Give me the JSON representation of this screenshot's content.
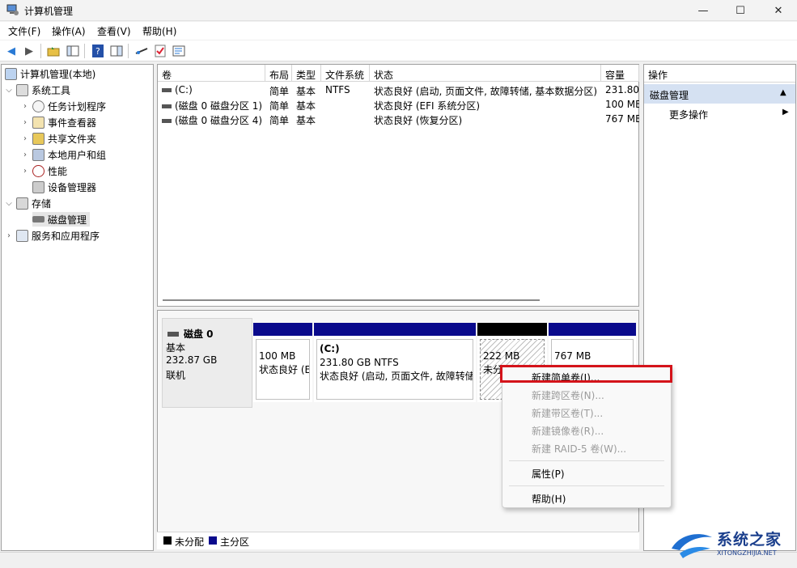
{
  "window": {
    "title": "计算机管理",
    "minimize": "—",
    "maximize": "☐",
    "close": "✕"
  },
  "menu": [
    "文件(F)",
    "操作(A)",
    "查看(V)",
    "帮助(H)"
  ],
  "toolbar_icons": [
    "back-arrow-icon",
    "forward-arrow-icon",
    "up-folder-icon",
    "console-tree-icon",
    "help-icon",
    "show-pane-icon",
    "connect-icon",
    "check-icon",
    "properties-icon"
  ],
  "tree": {
    "root": "计算机管理(本地)",
    "system_tools": "系统工具",
    "task_scheduler": "任务计划程序",
    "event_viewer": "事件查看器",
    "shared_folders": "共享文件夹",
    "local_users": "本地用户和组",
    "performance": "性能",
    "device_manager": "设备管理器",
    "storage": "存储",
    "disk_management": "磁盘管理",
    "services": "服务和应用程序"
  },
  "volume_table": {
    "headers": [
      "卷",
      "布局",
      "类型",
      "文件系统",
      "状态",
      "容量"
    ],
    "rows": [
      [
        "(C:)",
        "简单",
        "基本",
        "NTFS",
        "状态良好 (启动, 页面文件, 故障转储, 基本数据分区)",
        "231.80"
      ],
      [
        "(磁盘 0 磁盘分区 1)",
        "简单",
        "基本",
        "",
        "状态良好 (EFI 系统分区)",
        "100 MB"
      ],
      [
        "(磁盘 0 磁盘分区 4)",
        "简单",
        "基本",
        "",
        "状态良好 (恢复分区)",
        "767 MB"
      ]
    ]
  },
  "disk": {
    "name": "磁盘 0",
    "type": "基本",
    "size": "232.87 GB",
    "status": "联机",
    "partitions": [
      {
        "title": "",
        "size": "100 MB",
        "status": "状态良好 (EFI"
      },
      {
        "title": "(C:)",
        "size": "231.80 GB NTFS",
        "status": "状态良好 (启动, 页面文件, 故障转储"
      },
      {
        "title": "",
        "size": "222 MB",
        "status": "未分配"
      },
      {
        "title": "",
        "size": "767 MB",
        "status": ""
      }
    ]
  },
  "legend": {
    "unallocated": "未分配",
    "primary": "主分区"
  },
  "actions": {
    "header": "操作",
    "section": "磁盘管理",
    "more": "更多操作",
    "collapse_arrow": "▲",
    "more_arrow": "▶"
  },
  "context_menu": {
    "new_simple": "新建简单卷(I)...",
    "new_spanned": "新建跨区卷(N)...",
    "new_striped": "新建带区卷(T)...",
    "new_mirrored": "新建镜像卷(R)...",
    "new_raid5": "新建 RAID-5 卷(W)...",
    "properties": "属性(P)",
    "help": "帮助(H)"
  },
  "watermark": {
    "text": "系统之家",
    "url": "XITONGZHIJIA.NET"
  },
  "colors": {
    "primary_partition": "#0a0a8c",
    "unallocated": "#000000",
    "highlight": "#d4131a"
  }
}
